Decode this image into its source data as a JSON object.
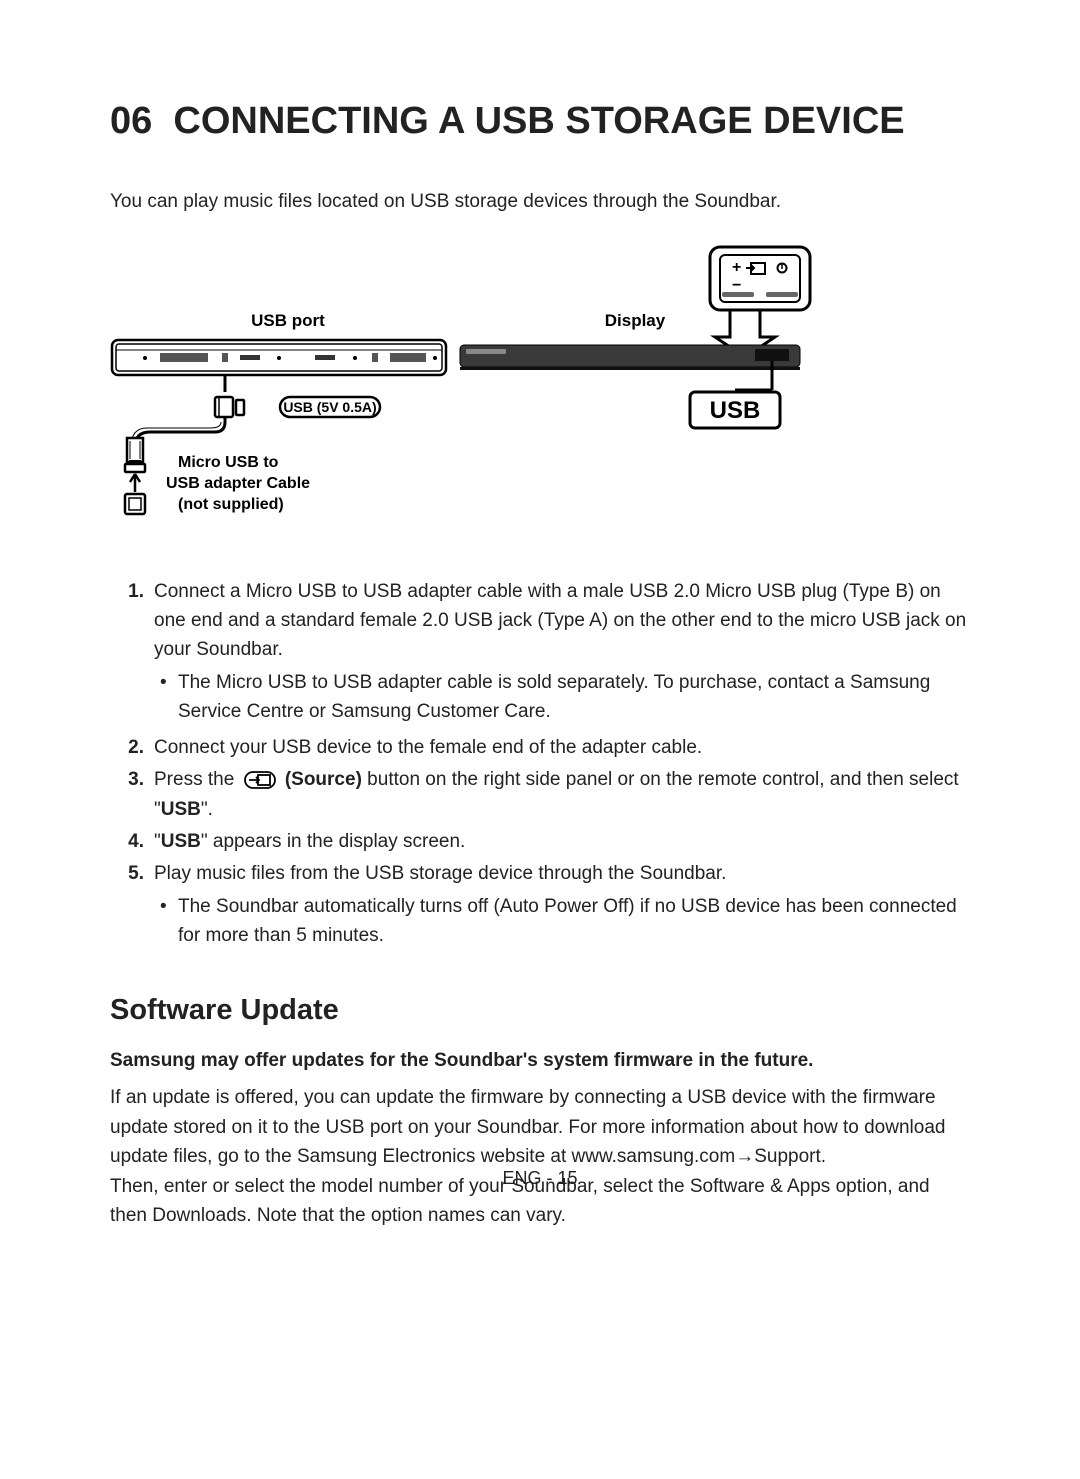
{
  "heading_num": "06",
  "heading_title": "CONNECTING A USB STORAGE DEVICE",
  "intro": "You can play music files located on USB storage devices through the Soundbar.",
  "diagram": {
    "usb_port_label": "USB port",
    "display_label": "Display",
    "usb_badge": "USB",
    "usb_5v": "USB (5V 0.5A)",
    "cable_line1": "Micro USB to",
    "cable_line2": "USB adapter Cable",
    "cable_line3": "(not supplied)"
  },
  "steps": {
    "s1": "Connect a Micro USB to USB adapter cable with a male USB 2.0 Micro USB plug (Type B) on one end and a standard female 2.0 USB jack (Type A) on the other end to the micro USB jack on your Soundbar.",
    "s1_bullet": "The Micro USB to USB adapter cable is sold separately. To purchase, contact a Samsung Service Centre or Samsung Customer Care.",
    "s2": "Connect your USB device to the female end of the adapter cable.",
    "s3_pre": "Press the ",
    "s3_source": " (Source)",
    "s3_post": " button on the right side panel or on the remote control, and then select \"",
    "s3_usb": "USB",
    "s3_end": "\".",
    "s4_pre": "\"",
    "s4_usb": "USB",
    "s4_post": "\" appears in the display screen.",
    "s5": "Play music files from the USB storage device through the Soundbar.",
    "s5_bullet": "The Soundbar automatically turns off (Auto Power Off) if no USB device has been connected for more than 5 minutes."
  },
  "software": {
    "heading": "Software Update",
    "bold": "Samsung may offer updates for the Soundbar's system firmware in the future.",
    "body1": "If an update is offered, you can update the firmware by connecting a USB device with the firmware update stored on it to the USB port on your Soundbar. For more information about how to download update files, go to the Samsung Electronics website at www.samsung.com→Support.",
    "body2": "Then, enter or select the model number of your Soundbar, select the Software & Apps option, and then Downloads. Note that the option names can vary."
  },
  "footer": "ENG - 15"
}
